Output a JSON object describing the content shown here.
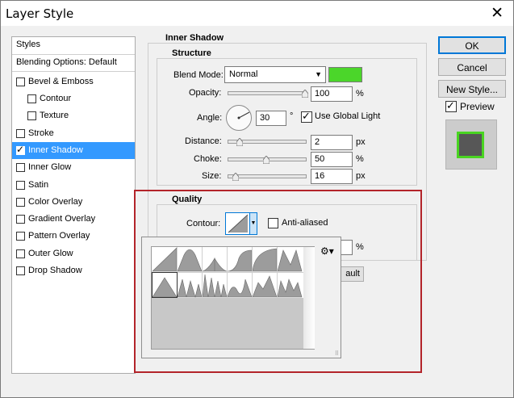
{
  "window": {
    "title": "Layer Style"
  },
  "styles_panel": {
    "header": "Styles",
    "blending_options": "Blending Options: Default",
    "items": [
      {
        "label": "Bevel & Emboss",
        "checked": false,
        "indent": false
      },
      {
        "label": "Contour",
        "checked": false,
        "indent": true
      },
      {
        "label": "Texture",
        "checked": false,
        "indent": true
      },
      {
        "label": "Stroke",
        "checked": false,
        "indent": false
      },
      {
        "label": "Inner Shadow",
        "checked": true,
        "indent": false,
        "selected": true
      },
      {
        "label": "Inner Glow",
        "checked": false,
        "indent": false
      },
      {
        "label": "Satin",
        "checked": false,
        "indent": false
      },
      {
        "label": "Color Overlay",
        "checked": false,
        "indent": false
      },
      {
        "label": "Gradient Overlay",
        "checked": false,
        "indent": false
      },
      {
        "label": "Pattern Overlay",
        "checked": false,
        "indent": false
      },
      {
        "label": "Outer Glow",
        "checked": false,
        "indent": false
      },
      {
        "label": "Drop Shadow",
        "checked": false,
        "indent": false
      }
    ]
  },
  "inner_shadow": {
    "section_title": "Inner Shadow",
    "structure_title": "Structure",
    "blend_mode_label": "Blend Mode:",
    "blend_mode_value": "Normal",
    "shadow_color": "#4bd62a",
    "opacity_label": "Opacity:",
    "opacity_value": "100",
    "opacity_unit": "%",
    "angle_label": "Angle:",
    "angle_value": "30",
    "angle_unit": "°",
    "use_global_light_label": "Use Global Light",
    "use_global_light_checked": true,
    "distance_label": "Distance:",
    "distance_value": "2",
    "distance_unit": "px",
    "choke_label": "Choke:",
    "choke_value": "50",
    "choke_unit": "%",
    "size_label": "Size:",
    "size_value": "16",
    "size_unit": "px"
  },
  "quality": {
    "title": "Quality",
    "contour_label": "Contour:",
    "anti_aliased_label": "Anti-aliased",
    "anti_aliased_checked": false,
    "noise_unit": "%",
    "reset_button_partial": "ault"
  },
  "buttons": {
    "ok": "OK",
    "cancel": "Cancel",
    "new_style": "New Style...",
    "preview_label": "Preview",
    "preview_checked": true
  },
  "contour_picker": {
    "gear_icon": "gear-icon",
    "presets_count": 12
  },
  "colors": {
    "selection": "#3399ff",
    "highlight_border": "#b3242a",
    "accent_green": "#49d521"
  }
}
